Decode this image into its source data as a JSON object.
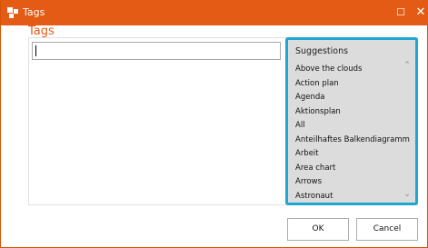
{
  "window": {
    "title": "Tags",
    "maximize_glyph": "☐",
    "close_glyph": "✕",
    "accent_color": "#e35b14"
  },
  "main": {
    "heading": "Tags",
    "input_value": ""
  },
  "suggestions": {
    "title": "Suggestions",
    "border_color": "#1ea7d1",
    "items": [
      "Above the clouds",
      "Action plan",
      "Agenda",
      "Aktionsplan",
      "All",
      "Anteilhaftes Balkendiagramm",
      "Arbeit",
      "Area chart",
      "Arrows",
      "Astronaut"
    ],
    "scroll_up_glyph": "⌃",
    "scroll_down_glyph": "⌄"
  },
  "buttons": {
    "ok": "OK",
    "cancel": "Cancel"
  }
}
